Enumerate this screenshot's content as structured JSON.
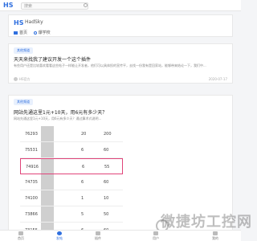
{
  "topbar": {
    "logo": "HS",
    "search_placeholder": "搜索"
  },
  "site": {
    "logo": "HS",
    "name": "HadSky",
    "nav": [
      "首页",
      "爆学校"
    ]
  },
  "posts": [
    {
      "tag": "其他频道",
      "title": "天天来找我了建议开发一个这个插件",
      "excerpt": "有些用户还是比较喜欢看看这些帖子一样能让开发者，他们可以具体投的宣传平，去找一份我有是回家站，能够带来结论一下，我们中...",
      "author": "HS官方",
      "date": "2020-07-17"
    },
    {
      "tag": "其他频道",
      "title": "网站先通这里1元+10天，用6元有多少天？",
      "excerpt": "网站先通这里1元+10天，用6元有多少天？通过算术式说明..."
    }
  ],
  "table": {
    "rows": [
      {
        "c1": "76293",
        "c3": "20",
        "c4": "200"
      },
      {
        "c1": "75531",
        "c3": "6",
        "c4": "60"
      },
      {
        "c1": "74916",
        "c3": "6",
        "c4": "55",
        "highlight": true
      },
      {
        "c1": "74735",
        "c3": "6",
        "c4": "60"
      },
      {
        "c1": "74100",
        "c3": "1",
        "c4": "10"
      },
      {
        "c1": "73866",
        "c3": "5",
        "c4": "50"
      },
      {
        "c1": "73155",
        "c3": "6",
        "c4": "60"
      }
    ]
  },
  "bottombar": {
    "items": [
      "首页",
      "发帖",
      "插件",
      "用户",
      "我的"
    ]
  },
  "watermark": "微捷坊工控网"
}
